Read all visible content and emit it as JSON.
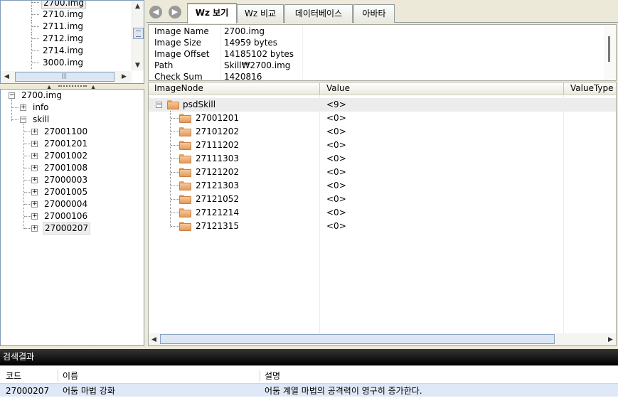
{
  "file_list": {
    "items": [
      {
        "label": "2700.img",
        "selected": true
      },
      {
        "label": "2710.img"
      },
      {
        "label": "2711.img"
      },
      {
        "label": "2712.img"
      },
      {
        "label": "2714.img"
      },
      {
        "label": "3000.img"
      }
    ]
  },
  "tree": {
    "root": "2700.img",
    "info": "info",
    "skill": "skill",
    "children": [
      "27001100",
      "27001201",
      "27001002",
      "27001008",
      "27000003",
      "27001005",
      "27000004",
      "27000106",
      "27000207"
    ],
    "selected_child": "27000207"
  },
  "tabs": [
    {
      "label": "Wz 보기",
      "active": true
    },
    {
      "label": "Wz 비교"
    },
    {
      "label": "데이터베이스"
    },
    {
      "label": "아바타"
    }
  ],
  "info": {
    "rows": [
      {
        "key": "Image Name",
        "value": "2700.img"
      },
      {
        "key": "Image Size",
        "value": "14959 bytes"
      },
      {
        "key": "Image Offset",
        "value": "14185102 bytes"
      },
      {
        "key": "Path",
        "value": "Skill₩2700.img"
      },
      {
        "key": "Check Sum",
        "value": "1420816"
      }
    ]
  },
  "grid": {
    "headers": {
      "node": "ImageNode",
      "value": "Value",
      "type": "ValueType"
    },
    "parent": {
      "name": "psdSkill",
      "value": "<9>"
    },
    "rows": [
      {
        "name": "27001201",
        "value": "<0>"
      },
      {
        "name": "27101202",
        "value": "<0>"
      },
      {
        "name": "27111202",
        "value": "<0>"
      },
      {
        "name": "27111303",
        "value": "<0>"
      },
      {
        "name": "27121202",
        "value": "<0>"
      },
      {
        "name": "27121303",
        "value": "<0>"
      },
      {
        "name": "27121052",
        "value": "<0>"
      },
      {
        "name": "27121214",
        "value": "<0>"
      },
      {
        "name": "27121315",
        "value": "<0>"
      }
    ]
  },
  "results": {
    "title": "검색결과",
    "headers": {
      "code": "코드",
      "name": "이름",
      "desc": "설명"
    },
    "row": {
      "code": "27000207",
      "name": "어둠 마법 강화",
      "desc": "어둠 계열 마법의 공격력이 영구히 증가한다."
    }
  },
  "colors": {
    "tab_accent": "#e68b2c",
    "folder": "#f2b77e",
    "results_bar": "#000000",
    "selected_row": "#dfe8f6"
  }
}
